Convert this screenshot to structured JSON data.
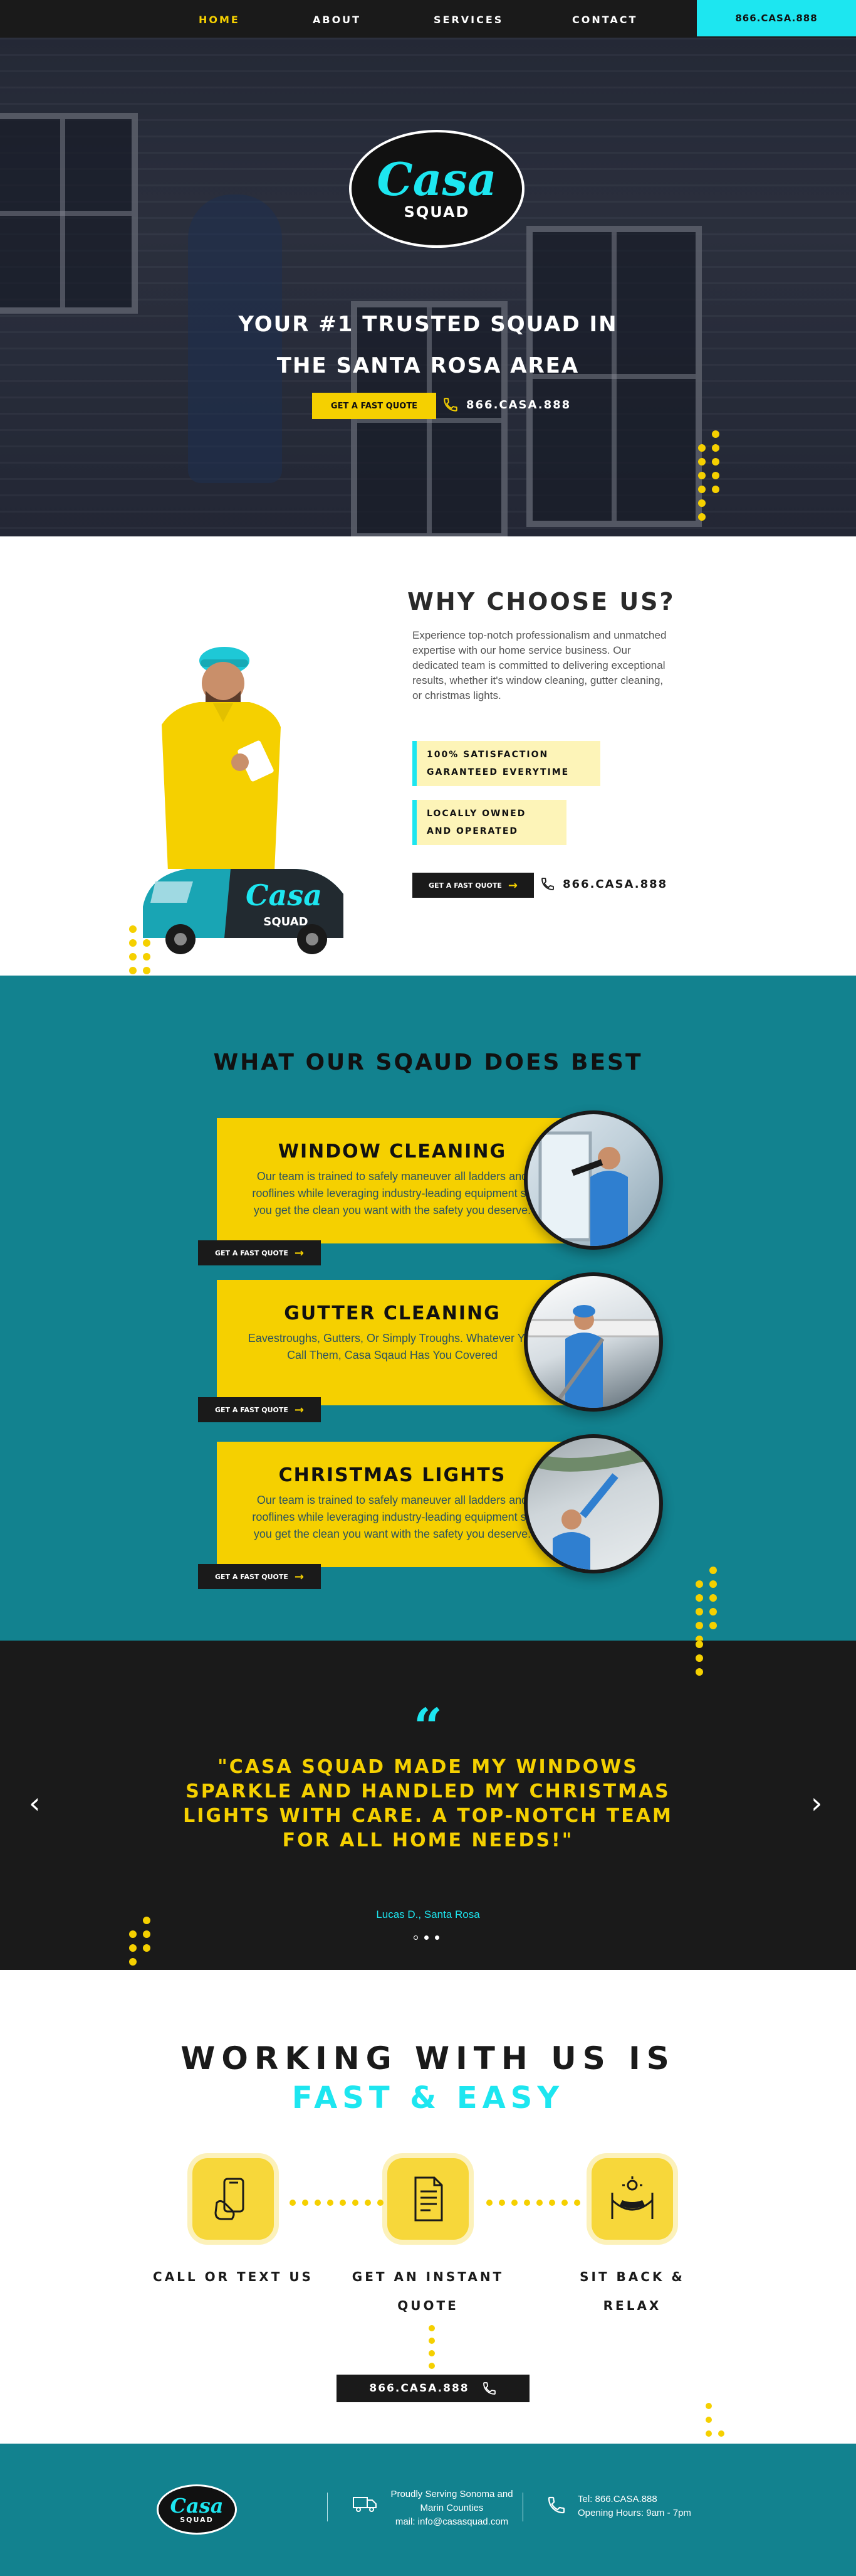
{
  "nav": {
    "items": [
      "HOME",
      "ABOUT",
      "SERVICES",
      "CONTACT"
    ],
    "phone": "866.CASA.888"
  },
  "brand": {
    "script": "Casa",
    "sub": "SQUAD"
  },
  "hero": {
    "headline_line1": "YOUR #1 TRUSTED SQUAD  IN",
    "headline_line2": "THE SANTA ROSA AREA",
    "cta": "GET A FAST QUOTE",
    "phone": "866.CASA.888"
  },
  "why": {
    "title": "WHY CHOOSE US?",
    "text": "Experience top-notch professionalism and unmatched expertise with our home service business. Our dedicated team is committed to delivering exceptional results, whether it's window cleaning, gutter cleaning, or christmas lights.",
    "badge1_line1": "100% SATISFACTION",
    "badge1_line2": "GARANTEED EVERYTIME",
    "badge2_line1": "LOCALLY OWNED",
    "badge2_line2": "AND OPERATED",
    "cta": "GET A FAST QUOTE",
    "phone": "866.CASA.888"
  },
  "services": {
    "title": "WHAT OUR SQAUD DOES BEST",
    "items": [
      {
        "title": "WINDOW CLEANING",
        "text": "Our team is trained to safely maneuver all ladders and rooflines while leveraging industry-leading equipment so you get the clean you want with the safety you deserve.",
        "cta": "GET A FAST QUOTE"
      },
      {
        "title": "GUTTER CLEANING",
        "text": "Eavestroughs, Gutters, Or Simply Troughs. Whatever You Call Them, Casa Sqaud Has You Covered",
        "cta": "GET A FAST QUOTE"
      },
      {
        "title": "CHRISTMAS LIGHTS",
        "text": "Our team is trained to safely maneuver all ladders and rooflines while leveraging industry-leading equipment so you get the clean you want with the safety you deserve.",
        "cta": "GET A FAST QUOTE"
      }
    ]
  },
  "testimonial": {
    "mark": "“",
    "quote": "\"CASA SQUAD MADE MY WINDOWS SPARKLE AND HANDLED MY CHRISTMAS LIGHTS WITH CARE. A TOP-NOTCH TEAM FOR ALL HOME NEEDS!\"",
    "author": "Lucas D., Santa Rosa",
    "prev": "‹",
    "next": "›"
  },
  "process": {
    "title": "WORKING WITH US IS",
    "subtitle": "FAST & EASY",
    "steps": [
      {
        "label": "CALL OR TEXT US",
        "icon": "phone-hand-icon"
      },
      {
        "label": "GET AN INSTANT QUOTE",
        "icon": "document-icon"
      },
      {
        "label": "SIT BACK & RELAX",
        "icon": "hammock-icon"
      }
    ],
    "phone": "866.CASA.888"
  },
  "footer": {
    "serving_line1": "Proudly Serving Sonoma and",
    "serving_line2": "Marin Counties",
    "email": "mail: info@casasquad.com",
    "tel": "Tel: 866.CASA.888",
    "hours": "Opening Hours: 9am - 7pm"
  },
  "colors": {
    "yellow": "#f5d000",
    "cyan": "#1de6f0",
    "teal": "#12828f",
    "dark": "#1a1a1a"
  }
}
